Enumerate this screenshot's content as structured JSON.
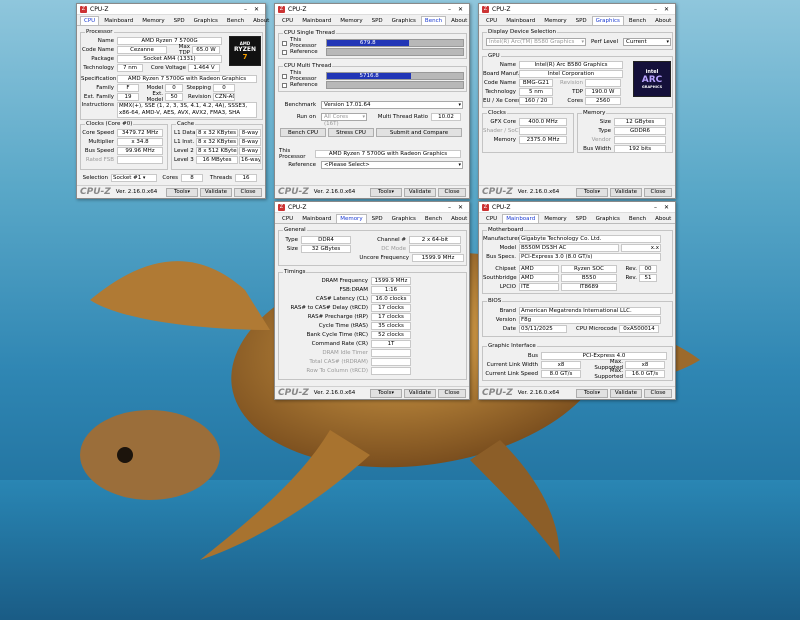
{
  "win_title": "CPU-Z",
  "version": "Ver. 2.16.0.x64",
  "footer": {
    "logo": "CPU-Z",
    "tools": "Tools",
    "validate": "Validate",
    "close": "Close"
  },
  "tabs": [
    "CPU",
    "Mainboard",
    "Memory",
    "SPD",
    "Graphics",
    "Bench",
    "About"
  ],
  "cpu": {
    "processor_title": "Processor",
    "name_l": "Name",
    "name": "AMD Ryzen 7 5700G",
    "codename_l": "Code Name",
    "codename": "Cezanne",
    "maxtdp_l": "Max TDP",
    "maxtdp": "65.0 W",
    "package_l": "Package",
    "package": "Socket AM4 (1331)",
    "tech_l": "Technology",
    "tech": "7 nm",
    "corev_l": "Core Voltage",
    "corev": "1.464 V",
    "spec_l": "Specification",
    "spec": "AMD Ryzen 7 5700G with Radeon Graphics",
    "family_l": "Family",
    "family": "F",
    "model_l": "Model",
    "model": "0",
    "stepping_l": "Stepping",
    "stepping": "0",
    "extfam_l": "Ext. Family",
    "extfam": "19",
    "extmodel_l": "Ext. Model",
    "extmodel": "50",
    "rev_l": "Revision",
    "rev": "CZN-A0",
    "instr_l": "Instructions",
    "instr": "MMX(+), SSE (1, 2, 3, 3S, 4.1, 4.2, 4A), SSSE3, x86-64, AMD-V, AES, AVX, AVX2, FMA3, SHA",
    "clocks_title": "Clocks (Core #0)",
    "corespeed_l": "Core Speed",
    "corespeed": "3479.72 MHz",
    "mult_l": "Multiplier",
    "mult": "x 34.8",
    "bus_l": "Bus Speed",
    "bus": "99.96 MHz",
    "rated_l": "Rated FSB",
    "rated": "",
    "cache_title": "Cache",
    "l1d_l": "L1 Data",
    "l1d": "8 x 32 KBytes",
    "l1d_w": "8-way",
    "l1i_l": "L1 Inst.",
    "l1i": "8 x 32 KBytes",
    "l1i_w": "8-way",
    "l2_l": "Level 2",
    "l2": "8 x 512 KBytes",
    "l2_w": "8-way",
    "l3_l": "Level 3",
    "l3": "16 MBytes",
    "l3_w": "16-way",
    "sel_l": "Selection",
    "sel": "Socket #1",
    "cores_l": "Cores",
    "cores": "8",
    "threads_l": "Threads",
    "threads": "16",
    "badge_top": "AMD",
    "badge_mid": "RYZEN",
    "badge_num": "7"
  },
  "bench": {
    "single_title": "CPU Single Thread",
    "this_l": "This Processor",
    "single_score": "679.8",
    "single_frac": 0.6,
    "ref_l": "Reference",
    "multi_title": "CPU Multi Thread",
    "multi_score": "5716.8",
    "multi_frac": 0.62,
    "benchmark_l": "Benchmark",
    "benchmark": "Version 17.01.64",
    "runon_l": "Run on",
    "runon": "All Cores (16T)",
    "ratio_l": "Multi Thread Ratio",
    "ratio": "10.02",
    "btn_bench": "Bench CPU",
    "btn_stress": "Stress CPU",
    "btn_submit": "Submit and Compare",
    "thisproc_l": "This Processor",
    "thisproc": "AMD Ryzen 7 5700G with Radeon Graphics",
    "reference_l": "Reference",
    "reference": "<Please Select>"
  },
  "gfx": {
    "dds_title": "Display Device Selection",
    "device": "Intel(R) Arc(TM) B580 Graphics",
    "perf_l": "Perf Level",
    "perf": "Current",
    "gpu_title": "GPU",
    "name_l": "Name",
    "name": "Intel(R) Arc B580 Graphics",
    "manuf_l": "Board Manuf.",
    "manuf": "Intel Corporation",
    "code_l": "Code Name",
    "code": "BMG-G21",
    "rev_l": "Revision",
    "rev": "",
    "tech_l": "Technology",
    "tech": "5 nm",
    "tdp_l": "TDP",
    "tdp": "190.0 W",
    "eu_l": "EU / Xe Cores",
    "eu": "160 / 20",
    "cores_l": "Cores",
    "cores": "2560",
    "clocks_title": "Clocks",
    "gfxcore_l": "GFX Core",
    "gfxcore": "400.0 MHz",
    "shader_l": "Shader / SoC",
    "shader": "",
    "memclk_l": "Memory",
    "memclk": "2375.0 MHz",
    "mem_title": "Memory",
    "size_l": "Size",
    "size": "12 GBytes",
    "type_l": "Type",
    "type": "GDDR6",
    "vendor_l": "Vendor",
    "vendor": "",
    "bw_l": "Bus Width",
    "bw": "192 bits",
    "badge_top": "intel",
    "badge_mid": "ARC",
    "badge_bot": "GRAPHICS"
  },
  "mem": {
    "gen_title": "General",
    "type_l": "Type",
    "type": "DDR4",
    "chan_l": "Channel #",
    "chan": "2 x 64-bit",
    "size_l": "Size",
    "size": "32 GBytes",
    "dc_l": "DC Mode",
    "dc": "",
    "uncore_l": "Uncore Frequency",
    "uncore": "1599.9 MHz",
    "tim_title": "Timings",
    "dram_l": "DRAM Frequency",
    "dram": "1599.9 MHz",
    "fsb_l": "FSB:DRAM",
    "fsb": "1:16",
    "cl_l": "CAS# Latency (CL)",
    "cl": "16.0 clocks",
    "trcd_l": "RAS# to CAS# Delay (tRCD)",
    "trcd": "17 clocks",
    "trp_l": "RAS# Precharge (tRP)",
    "trp": "17 clocks",
    "tras_l": "Cycle Time (tRAS)",
    "tras": "35 clocks",
    "trc_l": "Bank Cycle Time (tRC)",
    "trc": "52 clocks",
    "cr_l": "Command Rate (CR)",
    "cr": "1T",
    "idle_l": "DRAM Idle Timer",
    "idle": "",
    "total_l": "Total CAS# (tRDRAM)",
    "total": "",
    "rtc_l": "Row To Column (tRCD)",
    "rtc": ""
  },
  "mb": {
    "mb_title": "Motherboard",
    "manuf_l": "Manufacturer",
    "manuf": "Gigabyte Technology Co. Ltd.",
    "model_l": "Model",
    "model": "B550M DS3H AC",
    "model2": "x.x",
    "bus_l": "Bus Specs.",
    "bus": "PCI-Express 3.0 (8.0 GT/s)",
    "chipset_l": "Chipset",
    "chipset": "AMD",
    "chipset2": "Ryzen SOC",
    "rev_l": "Rev.",
    "chiprev": "00",
    "sb_l": "Southbridge",
    "sb": "AMD",
    "sb2": "B550",
    "sbrev": "51",
    "lpc_l": "LPCIO",
    "lpc": "ITE",
    "lpc2": "IT8689",
    "bios_title": "BIOS",
    "brand_l": "Brand",
    "brand": "American Megatrends International LLC.",
    "ver_l": "Version",
    "ver": "F8g",
    "date_l": "Date",
    "date": "03/11/2025",
    "ucode_l": "CPU Microcode",
    "ucode": "0xA500014",
    "gi_title": "Graphic Interface",
    "gbus_l": "Bus",
    "gbus": "PCI-Express 4.0",
    "clw_l": "Current Link Width",
    "clw": "x8",
    "msw_l": "Max. Supported",
    "msw": "x8",
    "cls_l": "Current Link Speed",
    "cls": "8.0 GT/s",
    "mss_l": "Max. Supported",
    "mss": "16.0 GT/s"
  }
}
